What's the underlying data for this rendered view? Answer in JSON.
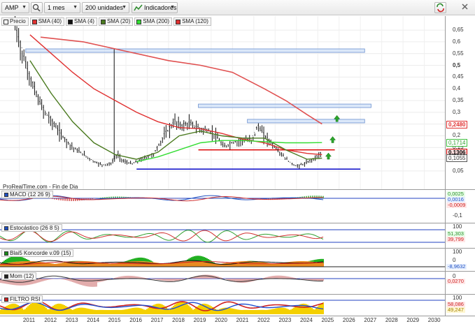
{
  "toolbar": {
    "symbol": "AMP",
    "period": "1 mes",
    "units": "200 unidades",
    "indicators": "Indicadores"
  },
  "legend": {
    "price": "Precio",
    "sma40": "SMA (40)",
    "sma4": "SMA (4)",
    "sma20": "SMA (20)",
    "sma200": "SMA (200)",
    "sma120": "SMA (120)"
  },
  "watermark": "ProRealTime.com - Fin de Dia",
  "price_axis": {
    "ticks": [
      "0,65",
      "0,6",
      "0,55",
      "0,5",
      "0,45",
      "0,4",
      "0,35",
      "0,3",
      "0,25",
      "0,2",
      "0,15",
      "0,1",
      "0,05"
    ],
    "tags": [
      {
        "label": "0,2480",
        "color": "#e03131",
        "bg": "#ffffff",
        "fg": "#e03131"
      },
      {
        "label": "0,1714",
        "color": "#40c040",
        "bg": "#ffffff",
        "fg": "#2f9f2f"
      },
      {
        "label": "0,1306",
        "color": "#cc0000",
        "bg": "#ffdddd",
        "fg": "#000000"
      },
      {
        "label": "0,1055",
        "color": "#555555",
        "bg": "#ffffff",
        "fg": "#333333"
      }
    ]
  },
  "panels": {
    "macd": {
      "label": "MACD (12 26 9)",
      "ticks": [
        "0,1",
        "-0,1"
      ],
      "tags": [
        "0,0025",
        "0,0016",
        "-0,0009"
      ]
    },
    "stoch": {
      "label": "Estocástico (26 8 5)",
      "ticks": [
        "100",
        "0"
      ],
      "tags": [
        "51,303",
        "39,799"
      ]
    },
    "blai5": {
      "label": "Blai5 Koncorde v.09 (15)",
      "ticks": [
        "100",
        "0"
      ],
      "tags": [
        "-8,9632"
      ]
    },
    "mom": {
      "label": "Mom (12)",
      "ticks": [
        "0"
      ],
      "tags": [
        "0,0270"
      ]
    },
    "filtro": {
      "label": "FILTRO RSI",
      "ticks": [
        "100"
      ],
      "tags": [
        "58,086",
        "49,247"
      ]
    }
  },
  "time_axis": [
    "2011",
    "2012",
    "2013",
    "2014",
    "2015",
    "2016",
    "2017",
    "2018",
    "2019",
    "2020",
    "2021",
    "2022",
    "2023",
    "2024",
    "2025",
    "2026",
    "2027",
    "2028",
    "2029",
    "2030"
  ],
  "chart_data": {
    "type": "line",
    "title": "AMP",
    "xlabel": "",
    "ylabel": "",
    "x_range": [
      2010.75,
      2030.9
    ],
    "ylim": [
      0.02,
      0.68
    ],
    "series": [
      {
        "name": "Precio",
        "color": "#111111",
        "x": [
          2010.8,
          2011.0,
          2011.3,
          2011.6,
          2011.9,
          2012.2,
          2012.6,
          2013.0,
          2013.5,
          2014.0,
          2014.5,
          2014.9,
          2015.3,
          2015.6,
          2015.9,
          2016.3,
          2016.8,
          2017.3,
          2017.8,
          2018.3,
          2018.6,
          2019.0,
          2019.4,
          2019.9,
          2020.2,
          2020.6,
          2021.0,
          2021.5,
          2021.9,
          2022.2,
          2022.5,
          2022.9,
          2023.3,
          2023.7,
          2024.0,
          2024.4,
          2024.8,
          2025.2
        ],
        "values": [
          0.66,
          0.6,
          0.5,
          0.42,
          0.35,
          0.3,
          0.25,
          0.2,
          0.15,
          0.12,
          0.09,
          0.075,
          0.08,
          0.12,
          0.09,
          0.08,
          0.1,
          0.12,
          0.2,
          0.26,
          0.24,
          0.25,
          0.23,
          0.22,
          0.2,
          0.15,
          0.17,
          0.18,
          0.18,
          0.24,
          0.2,
          0.16,
          0.12,
          0.085,
          0.07,
          0.08,
          0.1,
          0.13
        ]
      },
      {
        "name": "SMA (40)",
        "color": "#e03131",
        "x": [
          2011.5,
          2012.5,
          2013.5,
          2014.5,
          2015.5,
          2016.5,
          2017.5,
          2018.5,
          2019.5,
          2020.5,
          2021.5,
          2022.5,
          2023.5,
          2024.5,
          2025.2
        ],
        "values": [
          0.63,
          0.55,
          0.47,
          0.4,
          0.35,
          0.3,
          0.26,
          0.235,
          0.23,
          0.21,
          0.185,
          0.17,
          0.14,
          0.125,
          0.12
        ]
      },
      {
        "name": "SMA (20)",
        "color": "#4a7a1f",
        "x": [
          2011.5,
          2012.5,
          2013.5,
          2014.5,
          2015.5,
          2016.5,
          2017.5,
          2018.5,
          2019.5,
          2020.5,
          2021.5,
          2022.5,
          2023.5,
          2024.5,
          2025.2
        ],
        "values": [
          0.52,
          0.38,
          0.26,
          0.17,
          0.12,
          0.1,
          0.13,
          0.2,
          0.22,
          0.2,
          0.19,
          0.19,
          0.14,
          0.1,
          0.105
        ]
      },
      {
        "name": "SMA (200)",
        "color": "#e05050",
        "x": [
          2012.0,
          2014.0,
          2016.0,
          2018.0,
          2019.5,
          2021.0,
          2022.5,
          2023.5,
          2024.5,
          2025.2
        ],
        "values": [
          0.62,
          0.6,
          0.56,
          0.52,
          0.5,
          0.47,
          0.4,
          0.35,
          0.29,
          0.25
        ]
      },
      {
        "name": "SMA (120)",
        "color": "#33dd33",
        "x": [
          2016.5,
          2017.5,
          2018.5,
          2019.5,
          2020.5,
          2021.5,
          2022.5,
          2023.5,
          2024.5,
          2025.2
        ],
        "values": [
          0.09,
          0.11,
          0.14,
          0.17,
          0.18,
          0.18,
          0.175,
          0.17,
          0.17,
          0.171
        ]
      }
    ],
    "zones": [
      {
        "x": [
          2011.3,
          2027.2
        ],
        "y": [
          0.555,
          0.57
        ],
        "color": "#cfe0f7"
      },
      {
        "x": [
          2019.4,
          2027.5
        ],
        "y": [
          0.328,
          0.335
        ],
        "color": "#cfe0f7"
      },
      {
        "x": [
          2021.7,
          2027.2
        ],
        "y": [
          0.255,
          0.27
        ],
        "color": "#cfe0f7"
      }
    ],
    "hlines": [
      {
        "y": 0.14,
        "x": [
          2019.4,
          2025.8
        ],
        "color": "#dd0000"
      },
      {
        "y": 0.058,
        "x": [
          2016.5,
          2027.0
        ],
        "color": "#1a1acc"
      }
    ],
    "arrows_up": [
      {
        "x": 2025.9,
        "y": 0.275
      },
      {
        "x": 2025.7,
        "y": 0.185
      },
      {
        "x": 2025.5,
        "y": 0.115
      }
    ]
  }
}
